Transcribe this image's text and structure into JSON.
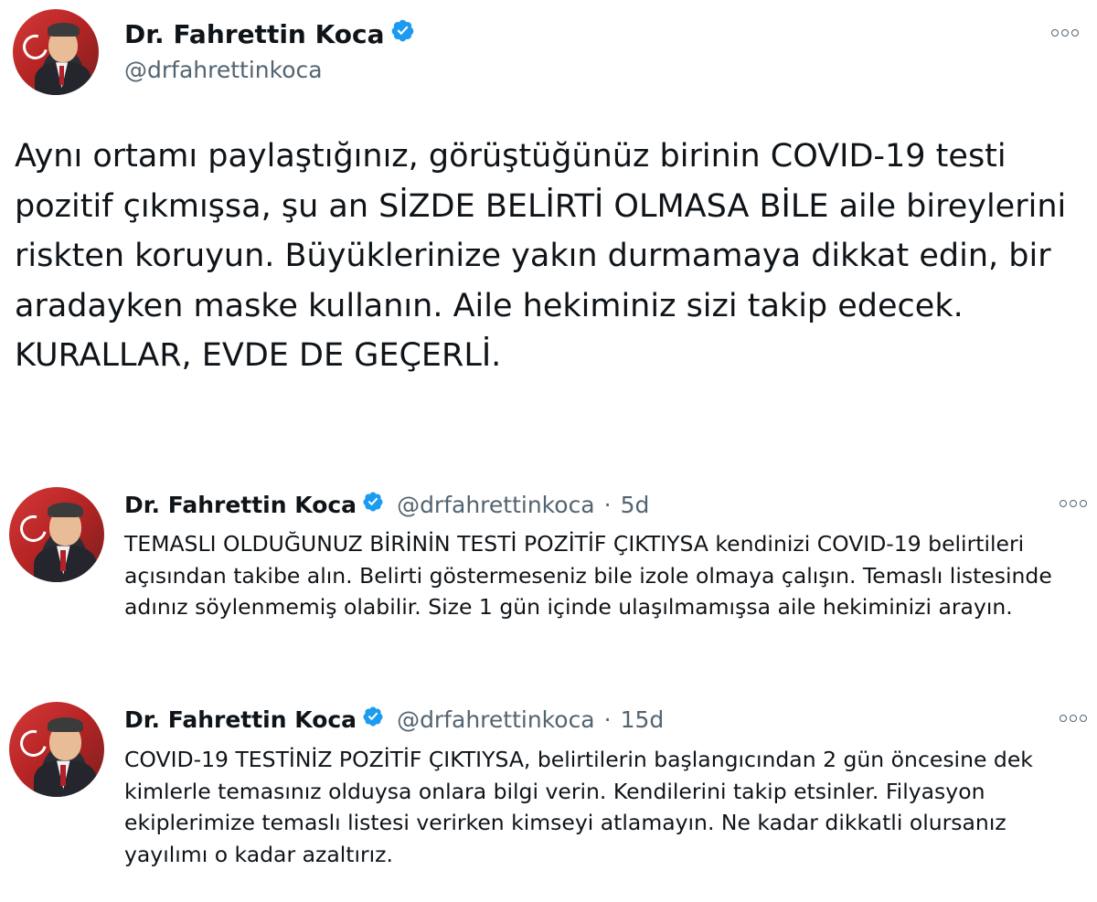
{
  "main_tweet": {
    "author_name": "Dr. Fahrettin Koca",
    "author_handle": "@drfahrettinkoca",
    "text": "Aynı ortamı paylaştığınız, görüştüğünüz birinin COVID-19 testi pozitif çıkmışsa, şu an SİZDE BELİRTİ OLMASA BİLE aile bireylerini riskten koruyun. Büyüklerinize yakın durmamaya dikkat edin, bir aradayken maske kullanın. Aile hekiminiz sizi takip edecek. KURALLAR, EVDE DE GEÇERLİ."
  },
  "thread": [
    {
      "author_name": "Dr. Fahrettin Koca",
      "author_handle": "@drfahrettinkoca",
      "separator": "·",
      "age": "5d",
      "text": "TEMASLI OLDUĞUNUZ BİRİNİN TESTİ POZİTİF ÇIKTIYSA kendinizi COVID-19 belirtileri açısından takibe alın. Belirti göstermeseniz bile izole olmaya çalışın. Temaslı listesinde adınız söylenmemiş olabilir. Size 1 gün içinde ulaşılmamışsa aile hekiminizi arayın."
    },
    {
      "author_name": "Dr. Fahrettin Koca",
      "author_handle": "@drfahrettinkoca",
      "separator": "·",
      "age": "15d",
      "text": "COVID-19 TESTİNİZ POZİTİF ÇIKTIYSA, belirtilerin başlangıcından 2 gün öncesine dek kimlerle temasınız olduysa onlara bilgi verin. Kendilerini takip etsinler. Filyasyon ekiplerimize temaslı listesi verirken kimseyi atlamayın. Ne kadar dikkatli olursanız yayılımı o kadar azaltırız."
    }
  ],
  "colors": {
    "text_primary": "#0f1419",
    "text_secondary": "#536471",
    "verified_blue": "#1d9bf0"
  },
  "icons": {
    "verified": "verified-badge-icon",
    "more": "more-options-icon"
  }
}
